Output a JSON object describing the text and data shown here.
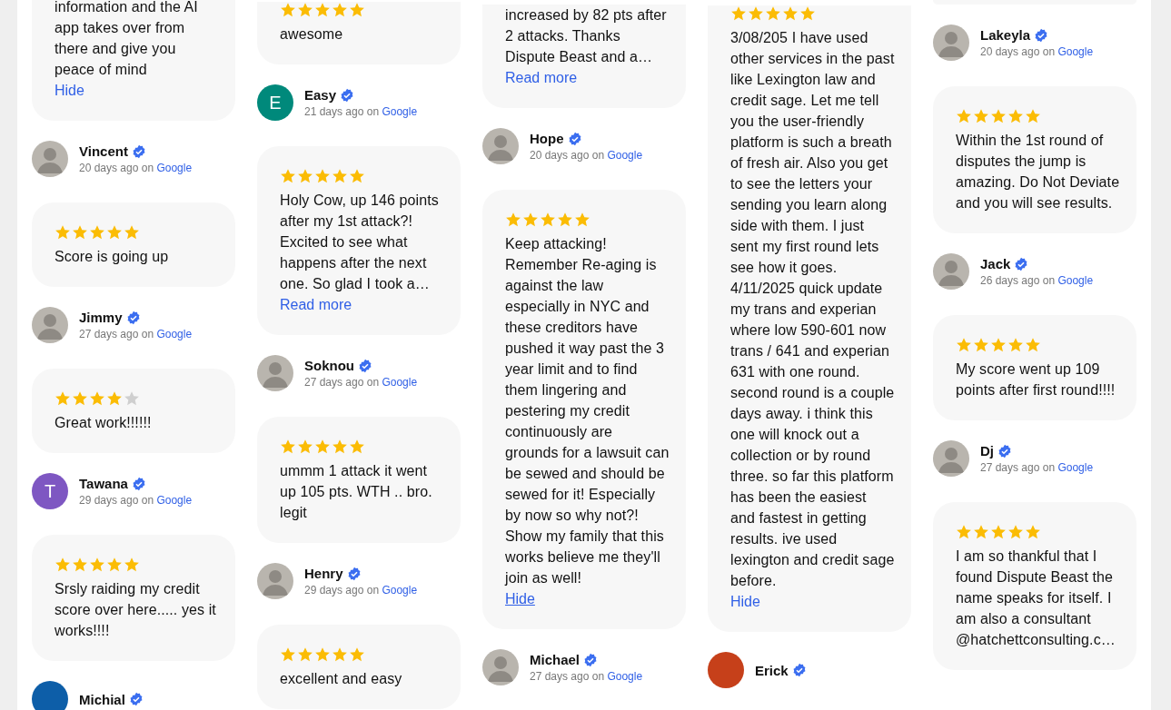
{
  "columns": [
    {
      "reviews": [
        {
          "text": "information and the AI app takes over from there and give you peace of mind",
          "toggle": {
            "label": "Hide",
            "hovered": false
          },
          "author": {
            "name": "Vincent",
            "avatar": {
              "kind": "photo"
            },
            "verified": true,
            "time": "20 days ago on",
            "source": "Google"
          }
        },
        {
          "stars": 5,
          "text": "Score is going up",
          "author": {
            "name": "Jimmy",
            "avatar": {
              "kind": "photo"
            },
            "verified": true,
            "time": "27 days ago on",
            "source": "Google"
          }
        },
        {
          "stars": 4,
          "text": "Great work!!!!!!",
          "author": {
            "name": "Tawana",
            "avatar": {
              "kind": "letter",
              "letter": "T",
              "color": "#7e57c2"
            },
            "verified": true,
            "time": "29 days ago on",
            "source": "Google"
          }
        },
        {
          "stars": 5,
          "text": "Srsly raiding my credit score over here..... yes it works!!!!",
          "author": {
            "name": "Michial",
            "avatar": {
              "kind": "letter",
              "color": "#0d5ea8"
            },
            "verified": true
          }
        }
      ]
    },
    {
      "reviews": [
        {
          "stars": 5,
          "text": "awesome",
          "author": {
            "name": "Easy",
            "avatar": {
              "kind": "letter",
              "letter": "E",
              "color": "#00897b"
            },
            "verified": true,
            "time": "21 days ago on",
            "source": "Google"
          }
        },
        {
          "stars": 5,
          "text": "Holy Cow, up 146 points after my 1st attack?! Excited to see what happens after the next one. So glad I took a…",
          "toggle": {
            "label": "Read more",
            "hovered": false
          },
          "author": {
            "name": "Soknou",
            "avatar": {
              "kind": "photo"
            },
            "verified": true,
            "time": "27 days ago on",
            "source": "Google"
          }
        },
        {
          "stars": 5,
          "text": "ummm 1 attack it went up 105 pts. WTH .. bro. legit",
          "author": {
            "name": "Henry",
            "avatar": {
              "kind": "photo"
            },
            "verified": true,
            "time": "29 days ago on",
            "source": "Google"
          }
        },
        {
          "stars": 5,
          "text": "excellent and easy"
        }
      ]
    },
    {
      "reviews": [
        {
          "text": "increased by 82 pts after 2 attacks. Thanks Dispute Beast and a…",
          "toggle": {
            "label": "Read more",
            "hovered": false
          },
          "author": {
            "name": "Hope",
            "avatar": {
              "kind": "photo"
            },
            "verified": true,
            "time": "20 days ago on",
            "source": "Google"
          }
        },
        {
          "stars": 5,
          "text": "Keep attacking! Remember Re-aging is against the law especially in NYC and these creditors have pushed it way past the 3 year limit and to find them lingering and pestering my credit continuously are grounds for a lawsuit can be sewed and should be sewed for it! Especially by now so why not?! Show my family that this works believe me they'll join as well!",
          "toggle": {
            "label": "Hide",
            "hovered": true
          },
          "author": {
            "name": "Michael",
            "avatar": {
              "kind": "photo"
            },
            "verified": true,
            "time": "27 days ago on",
            "source": "Google"
          }
        }
      ]
    },
    {
      "reviews": [
        {
          "stars": 5,
          "text": "3/08/205 I have used other services in the past like Lexington law and credit sage. Let me tell you the user-friendly platform is such a breath of fresh air. Also you get to see the letters your sending you learn along side with them. I just sent my first round lets see how it goes. 4/11/2025 quick update my trans and experian where low 590-601 now trans / 641 and experian 631 with one round. second round is a couple days away. i think this one will knock out a collection or by round three. so far this platform has been the easiest and fastest in getting results. ive used lexington and credit sage before.",
          "toggle": {
            "label": "Hide",
            "hovered": false
          },
          "author": {
            "name": "Erick",
            "avatar": {
              "kind": "letter",
              "color": "#c6401a"
            },
            "verified": true
          }
        }
      ]
    },
    {
      "reviews": [
        {
          "author": {
            "name": "Lakeyla",
            "avatar": {
              "kind": "photo"
            },
            "verified": true,
            "time": "20 days ago on",
            "source": "Google"
          }
        },
        {
          "stars": 5,
          "text": "Within the 1st round of disputes the jump is amazing. Do Not Deviate and you will see results.",
          "author": {
            "name": "Jack",
            "avatar": {
              "kind": "photo"
            },
            "verified": true,
            "time": "26 days ago on",
            "source": "Google"
          }
        },
        {
          "stars": 5,
          "text": "My score went up 109 points after first round!!!!",
          "author": {
            "name": "Dj",
            "avatar": {
              "kind": "photo"
            },
            "verified": true,
            "time": "27 days ago on",
            "source": "Google"
          }
        },
        {
          "stars": 5,
          "text": "I am so thankful that I found Dispute Beast the name speaks for itself. I am also a consultant @hatchettconsulting.c…"
        }
      ]
    }
  ]
}
